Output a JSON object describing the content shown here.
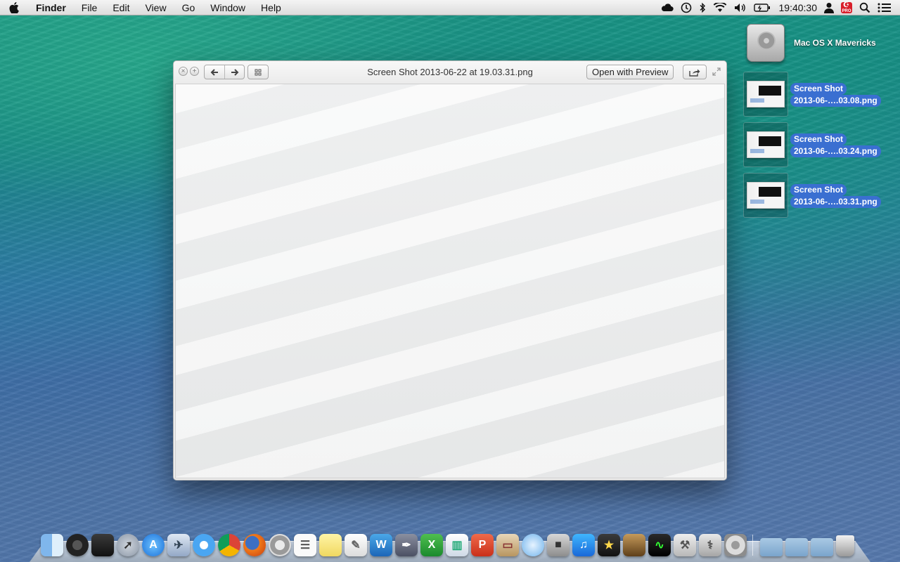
{
  "menubar": {
    "app_name": "Finder",
    "items": [
      "File",
      "Edit",
      "View",
      "Go",
      "Window",
      "Help"
    ],
    "clock": "19:40:30",
    "status_icons": [
      "cloud-icon",
      "time-machine-icon",
      "bluetooth-icon",
      "wifi-icon",
      "volume-icon",
      "battery-icon",
      "user-icon",
      "input-flag-icon",
      "spotlight-icon",
      "notification-center-icon"
    ],
    "flag_text": "PRO"
  },
  "desktop": {
    "drive": {
      "label": "Mac OS X Mavericks"
    },
    "files": [
      {
        "line1": "Screen Shot",
        "line2": "2013-06-….03.08.png"
      },
      {
        "line1": "Screen Shot",
        "line2": "2013-06-….03.24.png"
      },
      {
        "line1": "Screen Shot",
        "line2": "2013-06-….03.31.png"
      }
    ]
  },
  "quicklook": {
    "title": "Screen Shot 2013-06-22 at 19.03.31.png",
    "open_button": "Open with Preview",
    "close_glyph": "×",
    "fullscreen_glyph": "+"
  },
  "dock": {
    "apps": [
      "Finder",
      "Dashboard",
      "Mission Control",
      "Launchpad",
      "App Store",
      "Preview",
      "Safari",
      "Google Chrome",
      "Firefox",
      "Opera",
      "TextEdit",
      "Stickies",
      "Notes",
      "Microsoft Word",
      "Pixelmator",
      "Microsoft Excel",
      "Numbers",
      "Microsoft PowerPoint",
      "Keynote",
      "Messages",
      "FaceTime",
      "iTunes",
      "iMovie",
      "Image Capture",
      "Activity Monitor",
      "Xcode",
      "Disk Utility",
      "System Preferences"
    ],
    "stacks": [
      "Applications",
      "Documents",
      "Downloads"
    ],
    "trash": "Trash"
  },
  "colors": {
    "selection": "#3a6fd1",
    "menubar": "#e6e6e6"
  }
}
